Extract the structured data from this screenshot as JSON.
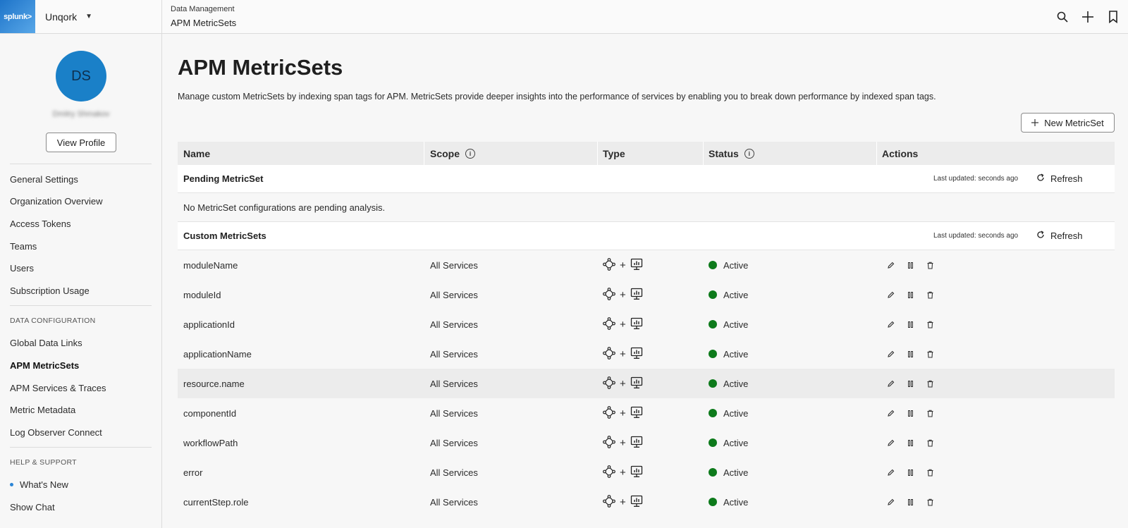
{
  "topbar": {
    "logo": "splunk>",
    "org": "Unqork",
    "breadcrumb_parent": "Data Management",
    "breadcrumb_current": "APM MetricSets"
  },
  "sidebar": {
    "avatar_initials": "DS",
    "username": "Dmitry Shmakov",
    "view_profile": "View Profile",
    "items_top": [
      "General Settings",
      "Organization Overview",
      "Access Tokens",
      "Teams",
      "Users",
      "Subscription Usage"
    ],
    "section_data": "DATA CONFIGURATION",
    "items_data": [
      "Global Data Links",
      "APM MetricSets",
      "APM Services & Traces",
      "Metric Metadata",
      "Log Observer Connect"
    ],
    "section_help": "HELP & SUPPORT",
    "items_help": [
      "What's New",
      "Show Chat"
    ]
  },
  "main": {
    "title": "APM MetricSets",
    "description": "Manage custom MetricSets by indexing span tags for APM. MetricSets provide deeper insights into the performance of services by enabling you to break down performance by indexed span tags.",
    "new_button": "New MetricSet",
    "columns": [
      "Name",
      "Scope",
      "Type",
      "Status",
      "Actions"
    ],
    "pending": {
      "title": "Pending MetricSet",
      "updated": "Last updated: seconds ago",
      "refresh": "Refresh",
      "empty": "No MetricSet configurations are pending analysis."
    },
    "custom": {
      "title": "Custom MetricSets",
      "updated": "Last updated: seconds ago",
      "refresh": "Refresh"
    },
    "rows": [
      {
        "name": "moduleName",
        "scope": "All Services",
        "status": "Active"
      },
      {
        "name": "moduleId",
        "scope": "All Services",
        "status": "Active"
      },
      {
        "name": "applicationId",
        "scope": "All Services",
        "status": "Active"
      },
      {
        "name": "applicationName",
        "scope": "All Services",
        "status": "Active"
      },
      {
        "name": "resource.name",
        "scope": "All Services",
        "status": "Active"
      },
      {
        "name": "componentId",
        "scope": "All Services",
        "status": "Active"
      },
      {
        "name": "workflowPath",
        "scope": "All Services",
        "status": "Active"
      },
      {
        "name": "error",
        "scope": "All Services",
        "status": "Active"
      },
      {
        "name": "currentStep.role",
        "scope": "All Services",
        "status": "Active"
      }
    ],
    "highlighted_row": 4,
    "status_color": "#0d7a1b"
  }
}
